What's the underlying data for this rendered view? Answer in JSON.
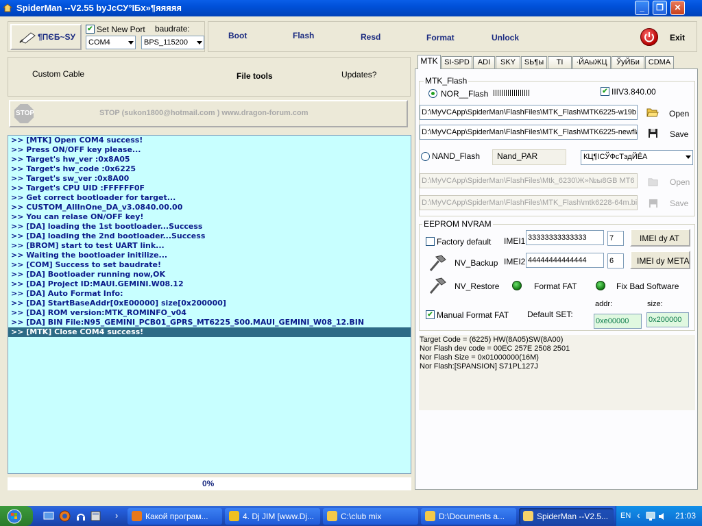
{
  "window": {
    "title": "SpiderMan --V2.55 byJcСУ°IБх»¶яяяяя"
  },
  "toolbar": {
    "logo_label": "¶ПЄБ~SУ",
    "set_new_port_label": "Set New Port",
    "set_new_port_checked": true,
    "baudrate_label": "baudrate:",
    "port_value": "COM4",
    "baud_value": "BPS_115200",
    "actions": [
      "Boot",
      "Flash",
      "Resd",
      "Format",
      "Unlock"
    ],
    "exit_label": "Exit"
  },
  "subbar": {
    "custom_cable": "Custom Cable",
    "file_tools": "File tools",
    "updates": "Updates?"
  },
  "stop_bar": {
    "icon_text": "STOP",
    "text": "STOP    (sukon1800@hotmail.com  ) www.dragon-forum.com"
  },
  "log": {
    "lines": [
      ">> [MTK] Open COM4 success!",
      ">> Press ON/OFF key please...",
      ">> Target's hw_ver :0x8A05",
      ">> Target's hw_code :0x6225",
      ">> Target's sw_ver :0x8A00",
      ">> Target's CPU UID :FFFFFF0F",
      ">> Get correct bootloader for target...",
      ">> CUSTOM_AllInOne_DA_v3.0840.00.00",
      ">> You can relase ON/OFF key!",
      ">> [DA] loading the 1st bootloader...Success",
      ">> [DA] loading the 2nd bootloader...Success",
      ">> [BROM] start to test UART link...",
      ">> Waiting the bootloader initilize...",
      ">> [COM] Success to set baudrate!",
      ">> [DA] Bootloader running now,OK",
      ">> [DA] Project ID:MAUI.GEMINI.W08.12",
      ">> [DA] Auto Format Info:",
      ">> [DA] StartBaseAddr[0xE00000] size[0x200000]",
      ">> [DA] ROM version:MTK_ROMINFO_v04",
      ">> [DA] BIN File:N95_GEMINI_PCB01_GPRS_MT6225_S00.MAUI_GEMINI_W08_12.BIN",
      ">> [MTK] Close COM4 success!"
    ],
    "selected_index": 20
  },
  "progress": {
    "text": "0%",
    "value": 0
  },
  "tabs": [
    "MTK",
    "SI-SPD",
    "ADI",
    "SKY",
    "SЬ¶ы",
    "TI",
    "·ЙАыЖЦ",
    "ЎуЙБи",
    "CDMA"
  ],
  "mtk_flash": {
    "group_label": "MTK_Flash",
    "nor_label": "NOR__Flash",
    "nor_selected": true,
    "version_label": "ІІІV3.840.00",
    "version_checked": true,
    "path1": "D:\\MyVCApp\\SpiderMan\\FlashFiles\\MTK_Flash\\MTK6225-w19b",
    "path2": "D:\\MyVCApp\\SpiderMan\\FlashFiles\\MTK_Flash\\MTK6225-newfla",
    "open_label": "Open",
    "save_label": "Save",
    "nand_label": "NAND_Flash",
    "nand_selected": false,
    "nand_par_label": "Nand_PAR",
    "nand_combo_value": "КЦ¶ІСЎФсТэдЙЁА",
    "path3": "D:\\MyVCApp\\SpiderMan\\FlashFiles\\Mtk_6230\\Ж»№ы8GB MT6",
    "path4": "D:\\MyVCApp\\SpiderMan\\FlashFiles\\MTK_Flash\\mtk6228-64m.bin",
    "open2_label": "Open",
    "save2_label": "Save"
  },
  "eeprom": {
    "group_label": "EEPROM NVRAM",
    "factory_default_label": "Factory default",
    "factory_default_checked": false,
    "imei1_label": "IMEI1",
    "imei1_value": "33333333333333",
    "imei1_digit": "7",
    "imei_at_label": "IMEI dy AT",
    "nv_backup_label": "NV_Backup",
    "imei2_label": "IMEI2",
    "imei2_value": "44444444444444",
    "imei2_digit": "6",
    "imei_meta_label": "IMEI dy META",
    "nv_restore_label": "NV_Restore",
    "format_fat_label": "Format FAT",
    "fix_bad_label": "Fix  Bad Software",
    "manual_format_label": "Manual Format FAT",
    "manual_format_checked": true,
    "default_set_label": "Default SET:",
    "addr_label": "addr:",
    "addr_value": "0xe00000",
    "size_label": "size:",
    "size_value": "0x200000"
  },
  "info": {
    "lines": [
      "Target Code = (6225) HW(8A05)SW(8A00)",
      "Nor Flash dev code = 00EC 257E 2508 2501",
      "Nor Flash Size = 0x01000000(16M)",
      "Nor Flash:[SPANSION] S71PL127J"
    ]
  },
  "taskbar": {
    "tasks": [
      "Какой програм...",
      "4. Dj JIM [www.Dj...",
      "C:\\club mix",
      "D:\\Documents a...",
      "SpiderMan --V2.5..."
    ],
    "active_index": 4,
    "lang": "EN",
    "clock": "21:03"
  },
  "colors": {
    "log_bg": "#c8ffff",
    "log_text": "#0a1a8a",
    "log_selected": "#2d6b86",
    "taskbar": "#245edb"
  }
}
